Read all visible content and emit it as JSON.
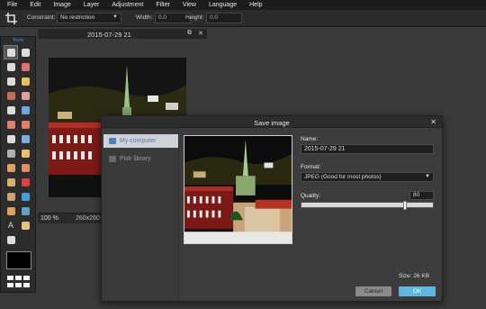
{
  "menu": [
    "File",
    "Edit",
    "Image",
    "Layer",
    "Adjustment",
    "Filter",
    "View",
    "Language",
    "Help"
  ],
  "options": {
    "constraint_label": "Constraint:",
    "constraint_value": "No restriction",
    "width_label": "Width:",
    "width_value": "0.0",
    "height_label": "Height:",
    "height_value": "0.0"
  },
  "tools": {
    "title": "Tools",
    "items": [
      "crop",
      "move",
      "marquee",
      "lasso",
      "wand",
      "pencil",
      "brush",
      "eraser",
      "bucket",
      "gradient",
      "stamp",
      "color-replace",
      "drawing",
      "blur",
      "sharpen",
      "smudge",
      "sponge",
      "dodge",
      "burn",
      "red-eye",
      "spot-heal",
      "bloat",
      "pinch",
      "color-picker",
      "type",
      "hand",
      "zoom"
    ],
    "colors": {
      "foreground": "#000000",
      "accent": "#4a90d9"
    }
  },
  "document": {
    "title": "2015-07-29 21",
    "zoom": "100",
    "zoom_unit": "%",
    "dimensions": "260x260"
  },
  "dialog": {
    "title": "Save image",
    "sidebar": {
      "my_computer": "My computer",
      "pixlr_library": "Pixlr library"
    },
    "name_label": "Name:",
    "name_value": "2015-07-29 21",
    "format_label": "Format:",
    "format_value": "JPEG (Good for most photos)",
    "quality_label": "Quality:",
    "quality_value": "80",
    "size_label": "Size:",
    "size_value": "26 KB",
    "cancel": "Cancel",
    "ok": "OK",
    "colors": {
      "ok": "#5cb8e0",
      "selected_item": "#cfd3d8"
    }
  }
}
